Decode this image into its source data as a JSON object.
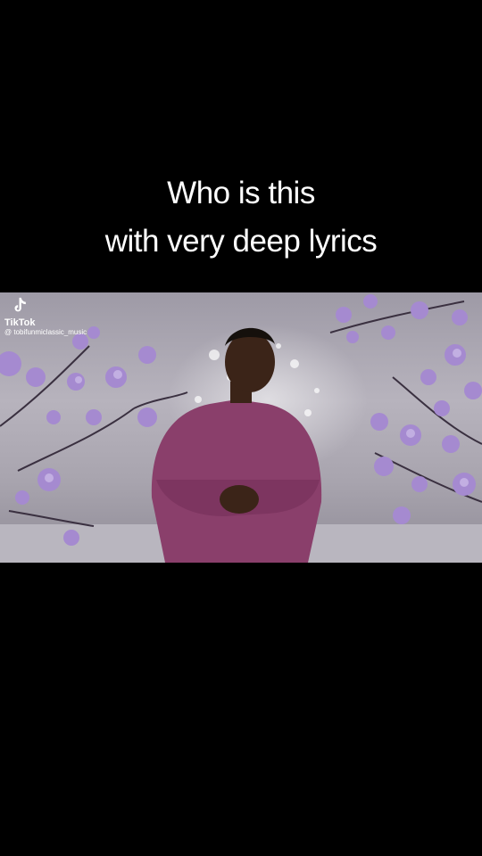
{
  "caption": {
    "line1": "Who is this",
    "line2": "with very deep lyrics"
  },
  "watermark": {
    "brand": "TikTok",
    "handle": "@ tobifunmiclassic_music",
    "icon": "tiktok-logo-icon"
  },
  "video": {
    "scene": "singer-in-purple-outfit"
  }
}
